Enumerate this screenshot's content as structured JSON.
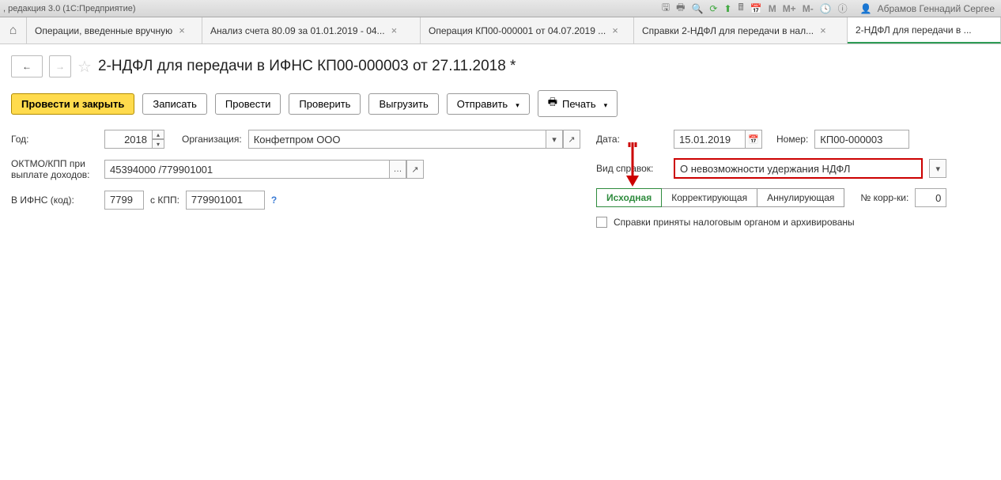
{
  "titlebar": {
    "text": ", редакция 3.0  (1С:Предприятие)",
    "user": "Абрамов Геннадий Сергее"
  },
  "tabs": [
    {
      "label": "Операции, введенные вручную",
      "closable": true,
      "active": false
    },
    {
      "label": "Анализ счета 80.09 за 01.01.2019 - 04...",
      "closable": true,
      "active": false
    },
    {
      "label": "Операция КП00-000001 от 04.07.2019 ...",
      "closable": true,
      "active": false
    },
    {
      "label": "Справки 2-НДФЛ для передачи в нал...",
      "closable": true,
      "active": false
    },
    {
      "label": "2-НДФЛ для передачи в ...",
      "closable": false,
      "active": true
    }
  ],
  "page": {
    "title": "2-НДФЛ для передачи в ИФНС КП00-000003 от 27.11.2018 *"
  },
  "toolbar": {
    "post_close": "Провести и закрыть",
    "record": "Записать",
    "post": "Провести",
    "check": "Проверить",
    "export": "Выгрузить",
    "send": "Отправить",
    "print": "Печать"
  },
  "form": {
    "year_label": "Год:",
    "year_value": "2018",
    "org_label": "Организация:",
    "org_value": "Конфетпром ООО",
    "oktmo_label1": "ОКТМО/КПП при",
    "oktmo_label2": "выплате доходов:",
    "oktmo_value": "45394000  /779901001",
    "ifns_label": "В ИФНС (код):",
    "ifns_value": "7799",
    "kpp_label": "с КПП:",
    "kpp_value": "779901001",
    "date_label": "Дата:",
    "date_value": "15.01.2019",
    "number_label": "Номер:",
    "number_value": "КП00-000003",
    "vid_label": "Вид справок:",
    "vid_value": "О невозможности удержания НДФЛ",
    "seg_initial": "Исходная",
    "seg_correcting": "Корректирующая",
    "seg_cancel": "Аннулирующая",
    "corr_label": "№ корр-ки:",
    "corr_value": "0",
    "archived_label": "Справки приняты налоговым органом и архивированы"
  }
}
